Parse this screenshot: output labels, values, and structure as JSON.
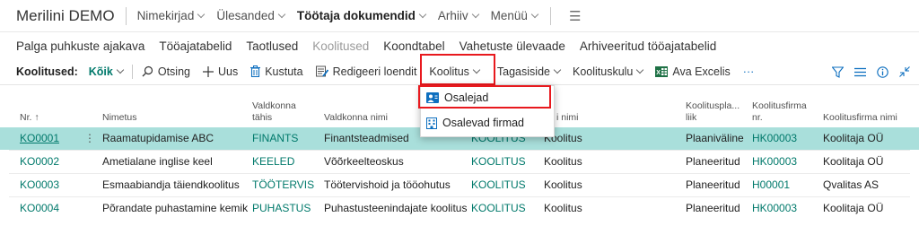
{
  "app": {
    "company": "Merilini DEMO"
  },
  "nav": [
    {
      "label": "Nimekirjad"
    },
    {
      "label": "Ülesanded"
    },
    {
      "label": "Töötaja dokumendid"
    },
    {
      "label": "Arhiiv"
    },
    {
      "label": "Menüü"
    }
  ],
  "subnav": [
    {
      "label": "Palga puhkuste ajakava"
    },
    {
      "label": "Tööajatabelid"
    },
    {
      "label": "Taotlused"
    },
    {
      "label": "Koolitused"
    },
    {
      "label": "Koondtabel"
    },
    {
      "label": "Vahetuste ülevaade"
    },
    {
      "label": "Arhiveeritud tööajatabelid"
    }
  ],
  "actionbar": {
    "title": "Koolitused:",
    "filter": "Kõik",
    "search": "Otsing",
    "new": "Uus",
    "delete": "Kustuta",
    "edit_list": "Redigeeri loendit",
    "training": "Koolitus",
    "feedback": "Tagasiside",
    "cost": "Koolituskulu",
    "excel": "Ava Excelis",
    "more": "···"
  },
  "dropdown": {
    "items": [
      {
        "label": "Osalejad"
      },
      {
        "label": "Osalevad firmad"
      }
    ]
  },
  "table": {
    "headers": {
      "nr": "Nr. ↑",
      "nimetus": "Nimetus",
      "valdkonna_tahis_1": "Valdkonna",
      "valdkonna_tahis_2": "tähis",
      "valdkonna_nimi": "Valdkonna nimi",
      "liik_nimi": "i nimi",
      "plaan_1": "Koolituspla...",
      "plaan_2": "liik",
      "firma_nr_1": "Koolitusfirma",
      "firma_nr_2": "nr.",
      "firma_nimi": "Koolitusfirma nimi"
    },
    "rows": [
      {
        "nr": "KO0001",
        "nimetus": "Raamatupidamise ABC",
        "tahis": "FINANTS",
        "valdkonna_nimi": "Finantsteadmised",
        "liik": "KOOLITUS",
        "liik_nimi": "Koolitus",
        "plaan": "Plaaniväline",
        "firma_nr": "HK00003",
        "firma_nimi": "Koolitaja OÜ",
        "more": "⋮"
      },
      {
        "nr": "KO0002",
        "nimetus": "Ametialane inglise keel",
        "tahis": "KEELED",
        "valdkonna_nimi": "Võõrkeelteoskus",
        "liik": "KOOLITUS",
        "liik_nimi": "Koolitus",
        "plaan": "Planeeritud",
        "firma_nr": "HK00003",
        "firma_nimi": "Koolitaja OÜ"
      },
      {
        "nr": "KO0003",
        "nimetus": "Esmaabiandja täiendkoolitus",
        "tahis": "TÖÖTERVIS",
        "valdkonna_nimi": "Töötervishoid ja tööohutus",
        "liik": "KOOLITUS",
        "liik_nimi": "Koolitus",
        "plaan": "Planeeritud",
        "firma_nr": "H00001",
        "firma_nimi": "Qvalitas AS"
      },
      {
        "nr": "KO0004",
        "nimetus": "Põrandate puhastamine kemik...",
        "tahis": "PUHASTUS",
        "valdkonna_nimi": "Puhastusteenindajate koolitused",
        "liik": "KOOLITUS",
        "liik_nimi": "Koolitus",
        "plaan": "Planeeritud",
        "firma_nr": "HK00003",
        "firma_nimi": "Koolitaja OÜ"
      }
    ]
  },
  "colors": {
    "accent": "#00796b",
    "selected_row": "#a9dfdb",
    "highlight": "#e8191e"
  }
}
